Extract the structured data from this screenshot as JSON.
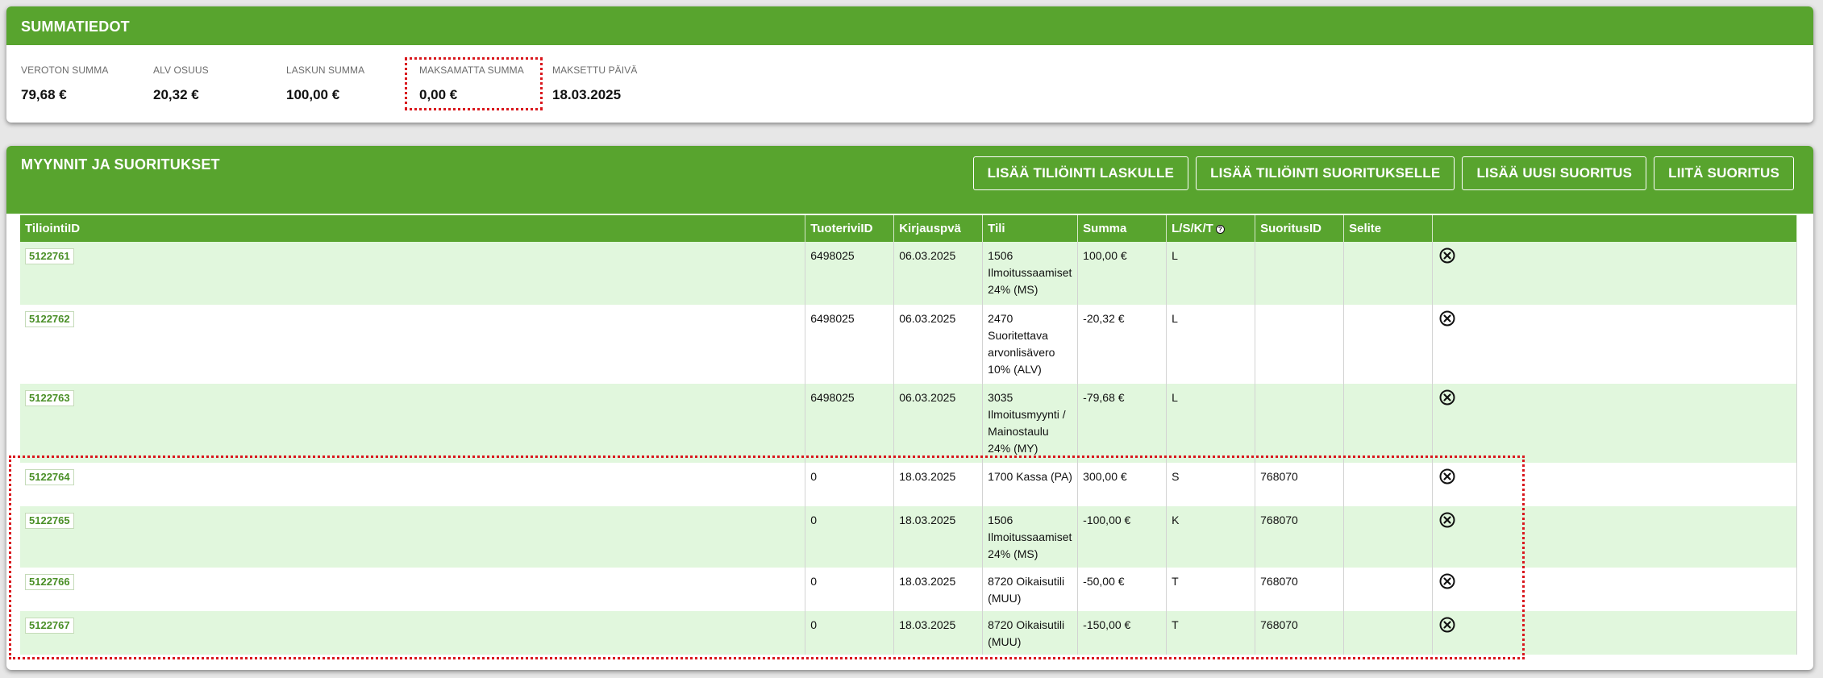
{
  "summary": {
    "title": "SUMMATIEDOT",
    "items": [
      {
        "label": "VEROTON SUMMA",
        "value": "79,68 €"
      },
      {
        "label": "ALV OSUUS",
        "value": "20,32 €"
      },
      {
        "label": "LASKUN SUMMA",
        "value": "100,00 €"
      },
      {
        "label": "MAKSAMATTA SUMMA",
        "value": "0,00 €"
      },
      {
        "label": "MAKSETTU PÄIVÄ",
        "value": "18.03.2025"
      }
    ]
  },
  "sales": {
    "title": "MYYNNIT JA SUORITUKSET",
    "buttons": {
      "add_invoice_entry": "LISÄÄ TILIÖINTI LASKULLE",
      "add_payment_entry": "LISÄÄ TILIÖINTI SUORITUKSELLE",
      "add_new_payment": "LISÄÄ UUSI SUORITUS",
      "attach_payment": "LIITÄ SUORITUS"
    },
    "columns": [
      "TiliointiID",
      "TuoteriviID",
      "Kirjauspvä",
      "Tili",
      "Summa",
      "L/S/K/T",
      "SuoritusID",
      "Selite",
      ""
    ],
    "help_icon": "?",
    "rows": [
      {
        "id": "5122761",
        "tuoterivi": "6498025",
        "pvm": "06.03.2025",
        "tili": "1506 Ilmoitussaamiset 24% (MS)",
        "summa": "100,00 €",
        "lskt": "L",
        "suoritus": "",
        "selite": ""
      },
      {
        "id": "5122762",
        "tuoterivi": "6498025",
        "pvm": "06.03.2025",
        "tili": "2470 Suoritettava arvonlisävero 10% (ALV)",
        "summa": "-20,32 €",
        "lskt": "L",
        "suoritus": "",
        "selite": ""
      },
      {
        "id": "5122763",
        "tuoterivi": "6498025",
        "pvm": "06.03.2025",
        "tili": "3035 Ilmoitusmyynti / Mainostaulu 24% (MY)",
        "summa": "-79,68 €",
        "lskt": "L",
        "suoritus": "",
        "selite": ""
      },
      {
        "id": "5122764",
        "tuoterivi": "0",
        "pvm": "18.03.2025",
        "tili": "1700 Kassa (PA)",
        "summa": "300,00 €",
        "lskt": "S",
        "suoritus": "768070",
        "selite": ""
      },
      {
        "id": "5122765",
        "tuoterivi": "0",
        "pvm": "18.03.2025",
        "tili": "1506 Ilmoitussaamiset 24% (MS)",
        "summa": "-100,00 €",
        "lskt": "K",
        "suoritus": "768070",
        "selite": ""
      },
      {
        "id": "5122766",
        "tuoterivi": "0",
        "pvm": "18.03.2025",
        "tili": "8720 Oikaisutili (MUU)",
        "summa": "-50,00 €",
        "lskt": "T",
        "suoritus": "768070",
        "selite": ""
      },
      {
        "id": "5122767",
        "tuoterivi": "0",
        "pvm": "18.03.2025",
        "tili": "8720 Oikaisutili (MUU)",
        "summa": "-150,00 €",
        "lskt": "T",
        "suoritus": "768070",
        "selite": ""
      }
    ]
  },
  "colors": {
    "header_green": "#58a42e",
    "row_alt": "#e1f7dd",
    "highlight_dotted": "#d9171d"
  },
  "icons": {
    "delete": "close-circle-icon",
    "help": "question-circle-icon"
  }
}
